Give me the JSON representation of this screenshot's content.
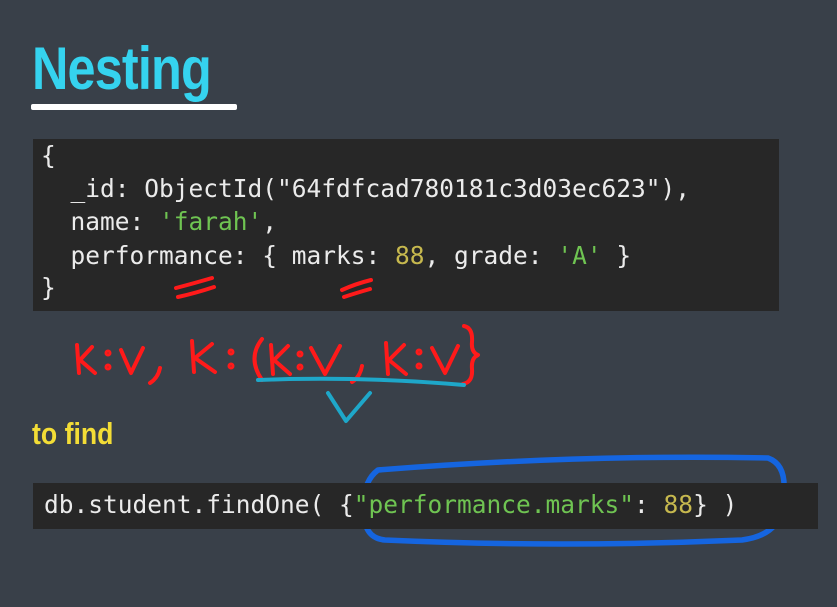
{
  "title": "Nesting",
  "code": {
    "open_brace": "{",
    "id_key": "_id: ObjectId(",
    "id_value": "\"64fdfcad780181c3d03ec623\"",
    "id_close": "),",
    "name_key": "name: ",
    "name_value": "'farah'",
    "comma": ",",
    "perf_key": "performance: { marks: ",
    "marks_value": "88",
    "grade_key": ", grade: ",
    "grade_value": "'A'",
    "perf_close": " }",
    "close_brace": "}"
  },
  "annotation": {
    "handwritten_formula": "k:v, k:(k:v, k:v)"
  },
  "subhead": "to find",
  "query": {
    "prefix": "db.student.findOne( {",
    "key": "\"performance.marks\"",
    "colon": ": ",
    "value": "88",
    "suffix": "} )"
  },
  "colors": {
    "background": "#394049",
    "code_background": "#272727",
    "title": "#35d3ef",
    "subhead": "#f3dd36",
    "string": "#6fc452",
    "number": "#c6b84e",
    "ink_red": "#ff1a1a",
    "ink_teal": "#1ea7c9",
    "ink_blue": "#1565e0"
  }
}
